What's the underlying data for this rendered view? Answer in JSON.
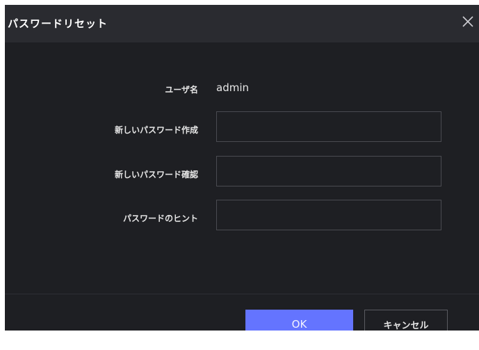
{
  "dialog": {
    "title": "パスワードリセット",
    "close_icon": "close-icon"
  },
  "form": {
    "username": {
      "label": "ユーザ名",
      "value": "admin"
    },
    "new_password": {
      "label": "新しいパスワード作成",
      "value": ""
    },
    "confirm_password": {
      "label": "新しいパスワード確認",
      "value": ""
    },
    "password_hint": {
      "label": "パスワードのヒント",
      "value": ""
    }
  },
  "buttons": {
    "ok_label": "OK",
    "cancel_label": "キャンセル"
  },
  "colors": {
    "dialog_background": "#1e1f23",
    "titlebar_background": "#2a2b30",
    "primary_button": "#6474ff",
    "field_border": "#4a4b51"
  }
}
